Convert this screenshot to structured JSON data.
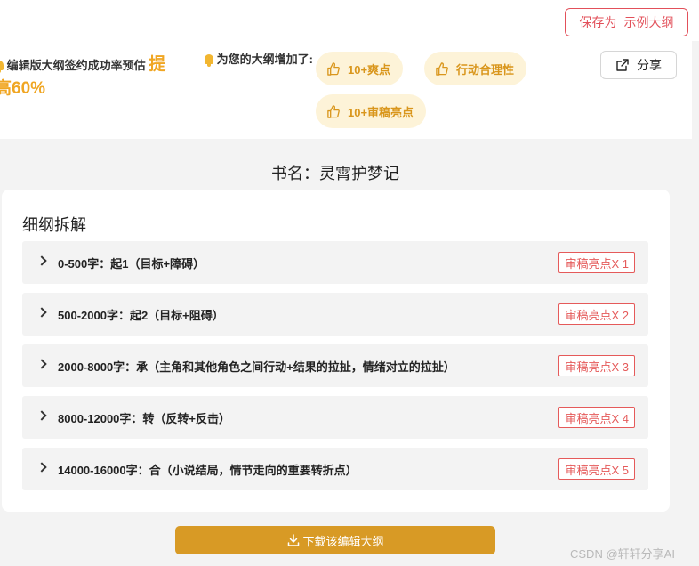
{
  "header": {
    "save_prefix": "保存为",
    "save_example": "示例大纲"
  },
  "panel": {
    "rate_text": "编辑版大纲签约成功率预估",
    "rate_big_1": "提",
    "rate_big_2": "高60%",
    "add_text": "为您的大纲增加了:",
    "chips": [
      "10+爽点",
      "行动合理性",
      "10+审稿亮点"
    ],
    "share_label": "分享"
  },
  "book_title": "书名：灵霄护梦记",
  "card": {
    "title": "细纲拆解",
    "rows": [
      {
        "label": "0-500字：起1（目标+障碍）",
        "badge": "审稿亮点X 1"
      },
      {
        "label": "500-2000字：起2（目标+阻碍）",
        "badge": "审稿亮点X 2"
      },
      {
        "label": "2000-8000字：承（主角和其他角色之间行动+结果的拉扯，情绪对立的拉扯）",
        "badge": "审稿亮点X 3"
      },
      {
        "label": "8000-12000字：转（反转+反击）",
        "badge": "审稿亮点X 4"
      },
      {
        "label": "14000-16000字：合（小说结局，情节走向的重要转折点）",
        "badge": "审稿亮点X 5"
      }
    ]
  },
  "download_label": "下载该编辑大纲",
  "watermark": "CSDN @轩轩分享AI",
  "colors": {
    "accent": "#d89a25",
    "chip_bg": "#fdf3d8",
    "chip_text": "#d9961c",
    "danger": "#e2505a"
  },
  "icons": {
    "bell": "bell-icon",
    "thumb": "thumbs-up-icon",
    "share": "share-icon",
    "chevron": "chevron-right-icon",
    "download": "download-icon"
  }
}
